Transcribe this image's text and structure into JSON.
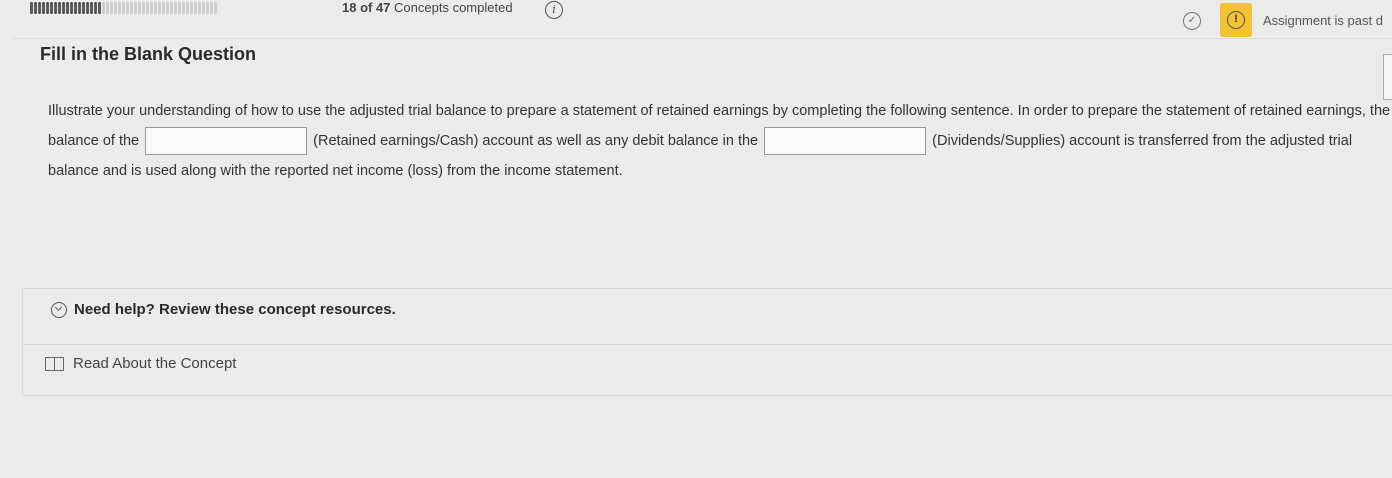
{
  "progress": {
    "completed": 18,
    "total": 47,
    "text_count": "18 of 47",
    "text_suffix": "Concepts completed"
  },
  "header": {
    "assignment_status": "Assignment is past d",
    "warn_color": "#f2c230"
  },
  "question": {
    "title": "Fill in the Blank Question",
    "text_1": "Illustrate your understanding of how to use the adjusted trial balance to prepare a statement of retained earnings by completing the following sentence. In order to prepare the statement of retained earnings, the balance of the",
    "text_2": "(Retained earnings/Cash) account as well as any debit balance in the",
    "text_3": "(Dividends/Supplies) account is transferred from the adjusted trial balance and is used along with the reported net income (loss) from the income statement.",
    "blank_1_value": "",
    "blank_2_value": ""
  },
  "help": {
    "toggle_label": "Need help? Review these concept resources.",
    "read_label": "Read About the Concept"
  },
  "icons": {
    "info": "info-icon",
    "check": "check-circle-icon",
    "warning": "warning-icon",
    "chevron": "chevron-down-circle-icon",
    "book": "book-icon"
  }
}
